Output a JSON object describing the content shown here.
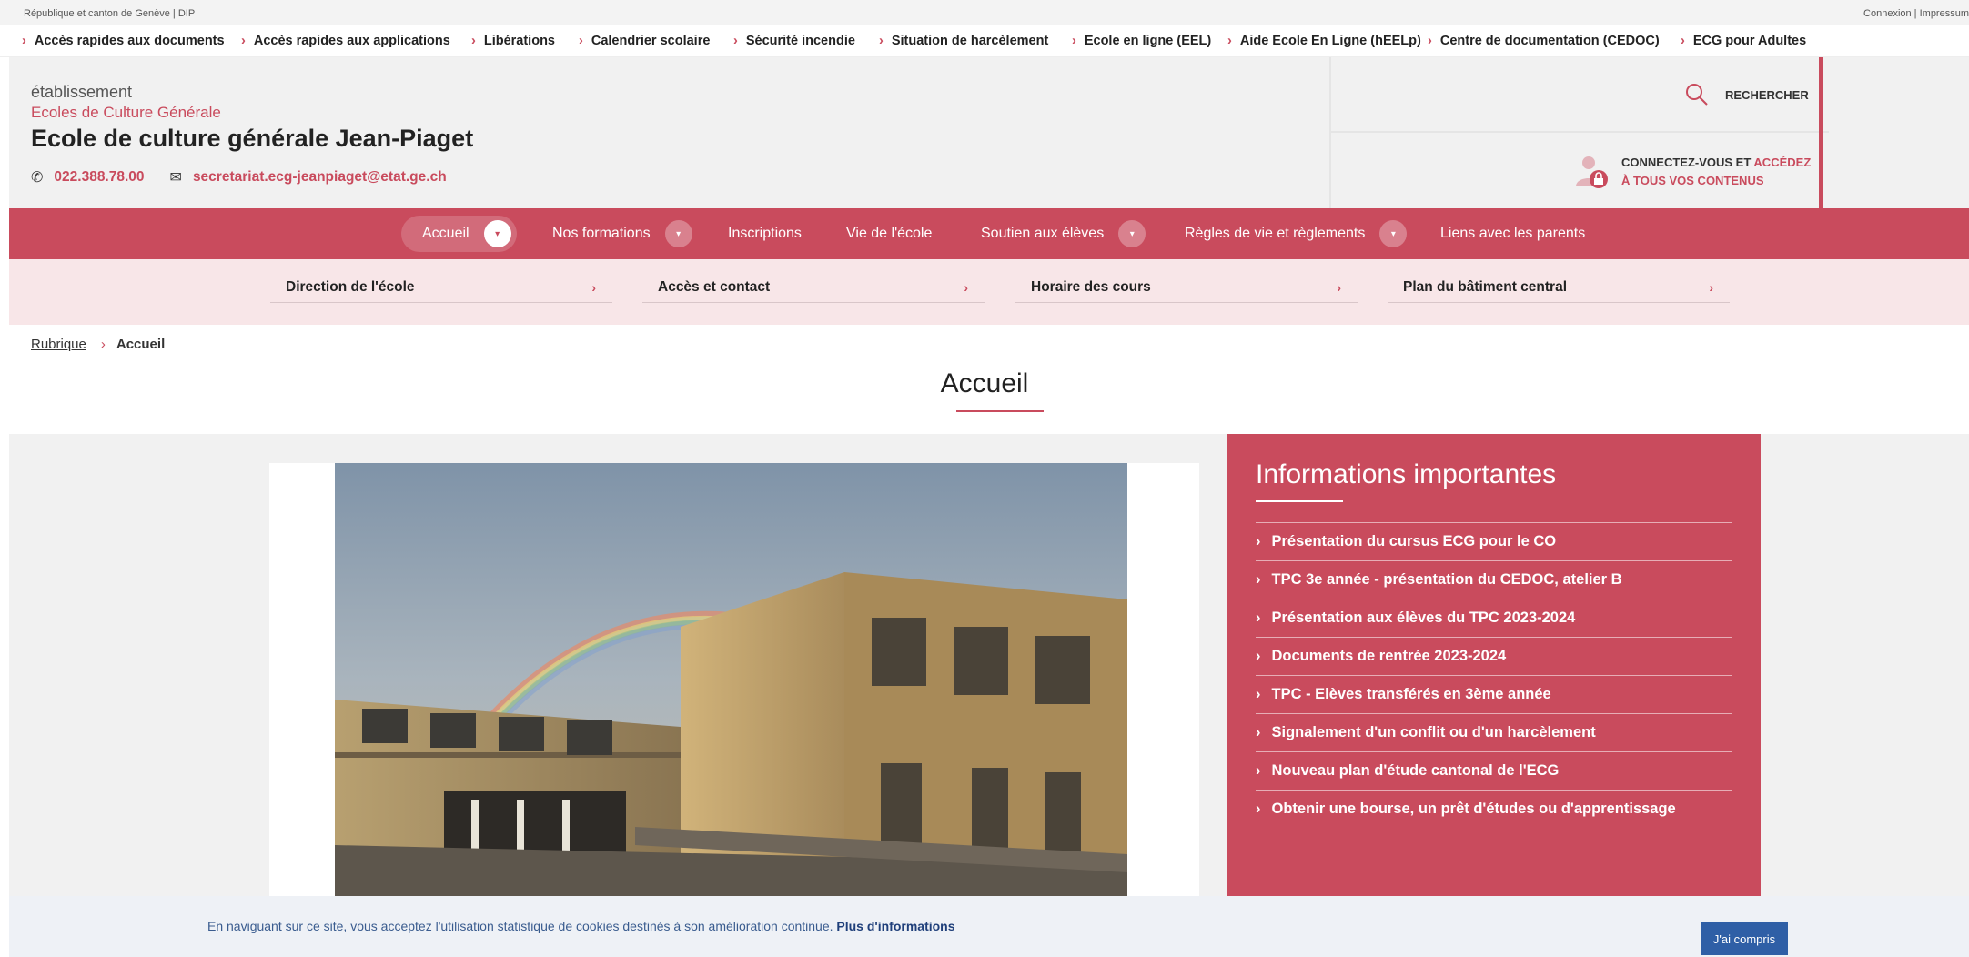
{
  "topbar": {
    "left": "République et canton de Genève | DIP",
    "right": "Connexion | Impressum"
  },
  "quick_links": [
    "Accès rapides aux documents",
    "Accès rapides aux applications",
    "Libérations",
    "Calendrier scolaire",
    "Sécurité incendie",
    "Situation de harcèlement",
    "Ecole en ligne (EEL)",
    "Aide Ecole En Ligne (hEELp)",
    "Centre de documentation (CEDOC)",
    "ECG pour Adultes"
  ],
  "header": {
    "etablissement": "établissement",
    "ecoles": "Ecoles de Culture Générale",
    "school_name": "Ecole de culture générale Jean-Piaget",
    "phone": "022.388.78.00",
    "email": "secretariat.ecg-jeanpiaget@etat.ge.ch",
    "search_label": "RECHERCHER",
    "login_line1_a": "CONNECTEZ-VOUS ET ",
    "login_line1_b": "ACCÉDEZ",
    "login_line2": "À TOUS VOS CONTENUS"
  },
  "main_nav": [
    {
      "label": "Accueil",
      "active": true,
      "dropdown": true
    },
    {
      "label": "Nos formations",
      "dropdown": true
    },
    {
      "label": "Inscriptions",
      "dropdown": false
    },
    {
      "label": "Vie de l'école",
      "dropdown": false
    },
    {
      "label": "Soutien aux élèves",
      "dropdown": true
    },
    {
      "label": "Règles de vie et règlements",
      "dropdown": true
    },
    {
      "label": "Liens avec les parents",
      "dropdown": false
    }
  ],
  "sub_nav": [
    "Direction de l'école",
    "Accès et contact",
    "Horaire des cours",
    "Plan du bâtiment central"
  ],
  "breadcrumb": {
    "root": "Rubrique",
    "current": "Accueil"
  },
  "page_title": "Accueil",
  "info": {
    "title": "Informations importantes",
    "items": [
      "Présentation du cursus ECG pour le CO",
      "TPC 3e année - présentation du CEDOC, atelier B",
      "Présentation aux élèves du TPC 2023-2024",
      "Documents de rentrée 2023-2024",
      "TPC - Elèves transférés en 3ème année",
      "Signalement d'un conflit ou d'un harcèlement",
      "Nouveau plan d'étude cantonal de l'ECG",
      "Obtenir une bourse, un prêt d'études ou d'apprentissage"
    ]
  },
  "cookie": {
    "message": "En naviguant sur ce site, vous acceptez l'utilisation statistique de cookies destinés à son amélioration continue.",
    "link": "Plus d'informations",
    "button": "J'ai compris"
  },
  "colors": {
    "accent": "#c94b5d",
    "subnav_bg": "#f8e6e8",
    "header_bg": "#f1f1f1",
    "cookie_button": "#2f5fa6"
  }
}
